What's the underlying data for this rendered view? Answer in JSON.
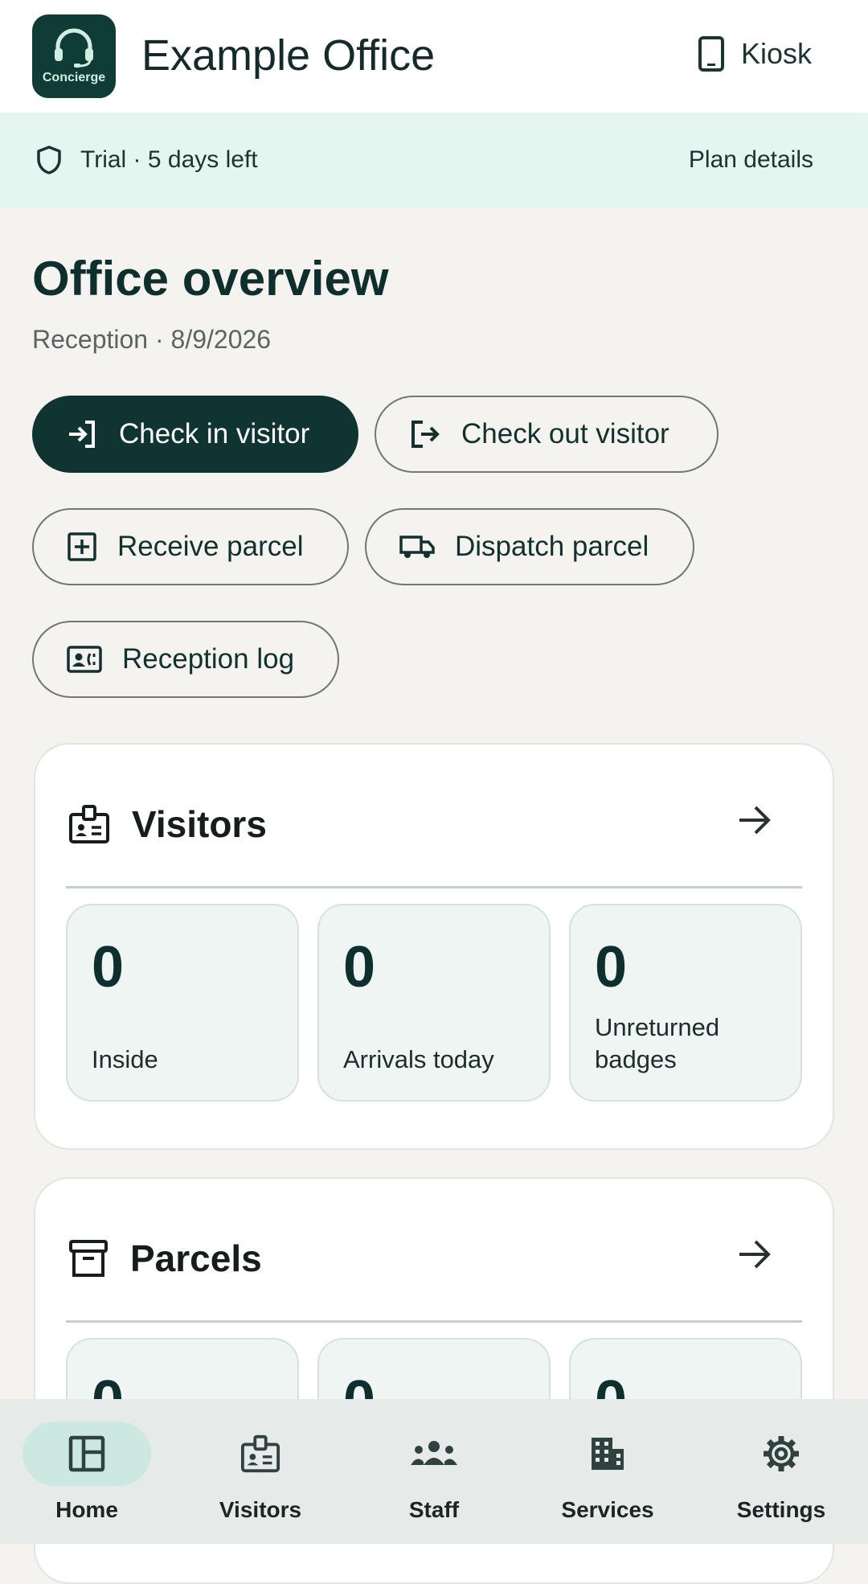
{
  "header": {
    "logo_text": "Concierge",
    "title": "Example Office",
    "kiosk_label": "Kiosk"
  },
  "banner": {
    "trial_text": "Trial · 5 days left",
    "plan_link": "Plan details"
  },
  "overview": {
    "title": "Office overview",
    "subtitle": "Reception · 8/9/2026"
  },
  "actions": {
    "check_in": "Check in visitor",
    "check_out": "Check out visitor",
    "receive_parcel": "Receive parcel",
    "dispatch_parcel": "Dispatch parcel",
    "reception_log": "Reception log"
  },
  "visitors_card": {
    "title": "Visitors",
    "stats": [
      {
        "value": "0",
        "label": "Inside"
      },
      {
        "value": "0",
        "label": "Arrivals today"
      },
      {
        "value": "0",
        "label": "Unreturned badges"
      }
    ]
  },
  "parcels_card": {
    "title": "Parcels",
    "stats": [
      {
        "value": "0"
      },
      {
        "value": "0"
      },
      {
        "value": "0"
      }
    ]
  },
  "nav": {
    "items": [
      {
        "label": "Home",
        "icon": "dashboard-icon",
        "active": true
      },
      {
        "label": "Visitors",
        "icon": "visitor-badge-icon",
        "active": false
      },
      {
        "label": "Staff",
        "icon": "group-icon",
        "active": false
      },
      {
        "label": "Services",
        "icon": "building-icon",
        "active": false
      },
      {
        "label": "Settings",
        "icon": "gear-icon",
        "active": false
      }
    ]
  },
  "colors": {
    "primary": "#0f3432",
    "banner_bg": "#e5f5ef",
    "page_bg": "#f4f3ef",
    "nav_active": "#cce9e1"
  }
}
